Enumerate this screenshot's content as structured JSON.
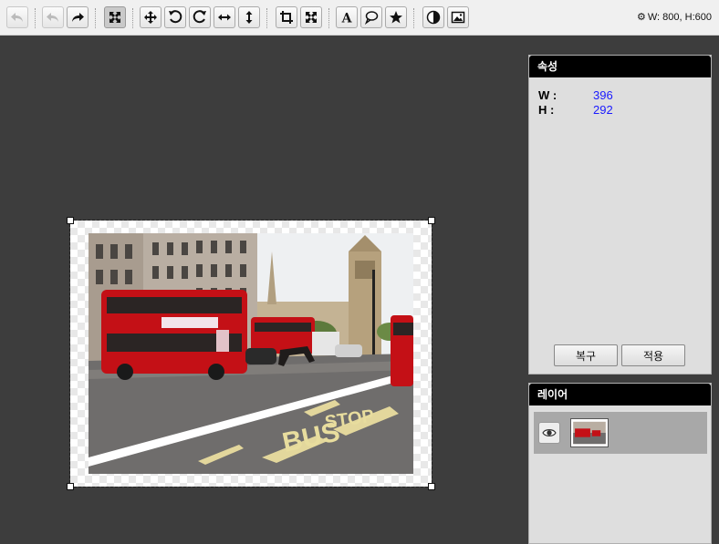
{
  "toolbar": {
    "buttons": [
      {
        "icon": "undo-all-icon",
        "state": "disabled"
      },
      {
        "icon": "undo-icon",
        "state": "disabled"
      },
      {
        "icon": "redo-icon",
        "state": "normal"
      },
      {
        "icon": "fit-screen-icon",
        "state": "active"
      },
      {
        "icon": "move-icon",
        "state": "normal"
      },
      {
        "icon": "rotate-left-icon",
        "state": "normal"
      },
      {
        "icon": "rotate-right-icon",
        "state": "normal"
      },
      {
        "icon": "flip-horizontal-icon",
        "state": "normal"
      },
      {
        "icon": "flip-vertical-icon",
        "state": "normal"
      },
      {
        "icon": "crop-icon",
        "state": "normal"
      },
      {
        "icon": "resize-icon",
        "state": "normal"
      },
      {
        "icon": "text-icon",
        "state": "normal"
      },
      {
        "icon": "speech-bubble-icon",
        "state": "normal"
      },
      {
        "icon": "star-icon",
        "state": "normal"
      },
      {
        "icon": "contrast-icon",
        "state": "normal"
      },
      {
        "icon": "image-icon",
        "state": "normal"
      }
    ],
    "size_info": "W: 800, H:600"
  },
  "properties": {
    "title": "속성",
    "w_label": "W :",
    "w_value": "396",
    "h_label": "H :",
    "h_value": "292",
    "reset_label": "복구",
    "apply_label": "적용"
  },
  "layers": {
    "title": "레이어",
    "items": [
      {
        "visible": true
      }
    ]
  },
  "colors": {
    "workspace_bg": "#3d3d3d",
    "toolbar_bg": "#f0f0f0",
    "panel_header": "#000000",
    "value_text": "#1a1aff"
  }
}
